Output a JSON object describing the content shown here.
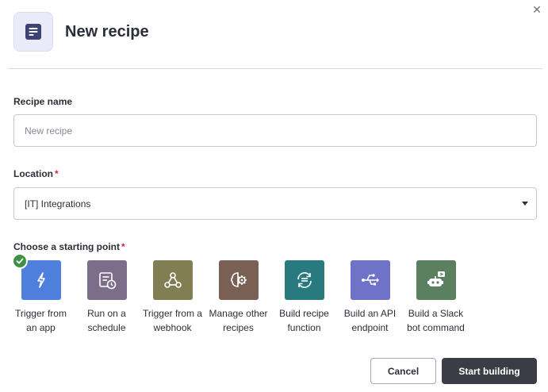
{
  "dialog": {
    "title": "New recipe",
    "close_icon": "close-icon"
  },
  "recipe_name": {
    "label": "Recipe name",
    "placeholder": "New recipe",
    "value": ""
  },
  "location": {
    "label": "Location",
    "required_mark": "*",
    "value": "[IT] Integrations"
  },
  "starting_point": {
    "label": "Choose a starting point",
    "required_mark": "*",
    "options": [
      {
        "label": "Trigger from\nan app",
        "icon": "lightning-icon",
        "color": "#4f7fdc",
        "selected": true
      },
      {
        "label": "Run on a\nschedule",
        "icon": "calendar-clock-icon",
        "color": "#7c6d8a",
        "selected": false
      },
      {
        "label": "Trigger from a\nwebhook",
        "icon": "webhook-icon",
        "color": "#827e53",
        "selected": false
      },
      {
        "label": "Manage other\nrecipes",
        "icon": "brain-gear-icon",
        "color": "#7a5f55",
        "selected": false
      },
      {
        "label": "Build recipe\nfunction",
        "icon": "function-cycle-icon",
        "color": "#287a7e",
        "selected": false
      },
      {
        "label": "Build an API\nendpoint",
        "icon": "usb-api-icon",
        "color": "#6f73c7",
        "selected": false
      },
      {
        "label": "Build a Slack\nbot command",
        "icon": "slack-bot-icon",
        "color": "#5a8060",
        "selected": false
      }
    ]
  },
  "buttons": {
    "cancel": "Cancel",
    "start": "Start building"
  },
  "colors": {
    "primary_button": "#3a3d46",
    "required": "#d6273b",
    "selected_check": "#3f9142"
  }
}
